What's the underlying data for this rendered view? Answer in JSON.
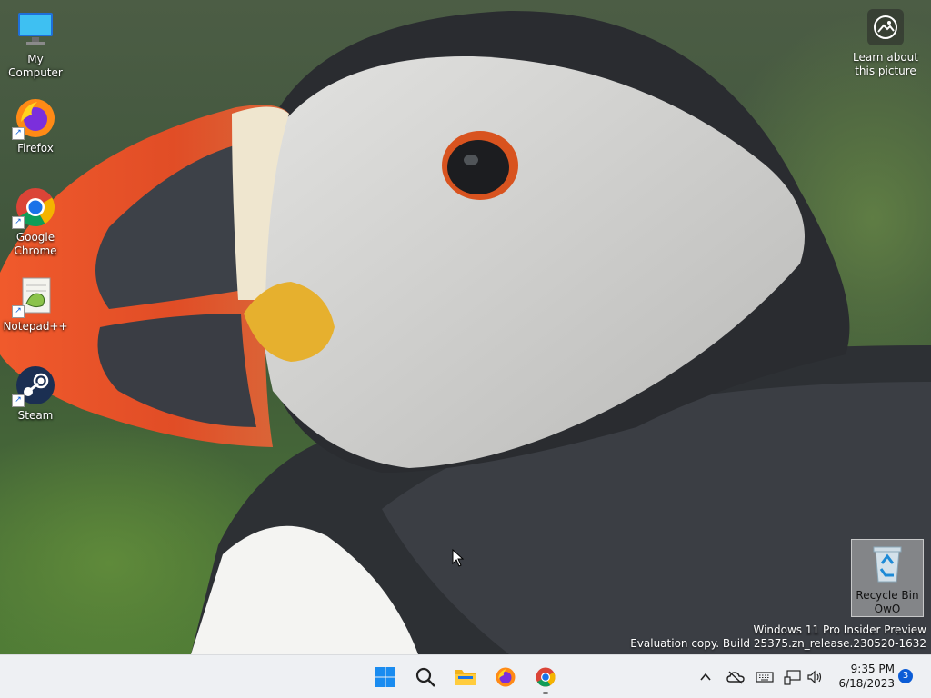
{
  "desktop": {
    "icons": [
      {
        "label": "My Computer",
        "icon": "monitor-icon"
      },
      {
        "label": "Firefox",
        "icon": "firefox-icon"
      },
      {
        "label": "Google Chrome",
        "icon": "chrome-icon"
      },
      {
        "label": "Notepad++",
        "icon": "notepadpp-icon"
      },
      {
        "label": "Steam",
        "icon": "steam-icon"
      }
    ],
    "learn_about": {
      "line1": "Learn about",
      "line2": "this picture",
      "icon": "camera-icon"
    },
    "recycle_bin": {
      "line1": "Recycle Bin",
      "line2": "OwO",
      "icon": "recycle-bin-icon"
    },
    "watermark": {
      "line1": "Windows 11 Pro Insider Preview",
      "line2": "Evaluation copy. Build 25375.zn_release.230520-1632"
    }
  },
  "taskbar": {
    "apps": [
      {
        "name": "start",
        "icon": "windows-logo-icon"
      },
      {
        "name": "search",
        "icon": "search-icon"
      },
      {
        "name": "file-explorer",
        "icon": "folder-icon"
      },
      {
        "name": "firefox",
        "icon": "firefox-icon"
      },
      {
        "name": "chrome",
        "icon": "chrome-icon"
      }
    ],
    "tray": {
      "icons": [
        "chevron-up-icon",
        "onedrive-offline-icon",
        "keyboard-icon",
        "network-icon",
        "volume-icon"
      ],
      "time": "9:35 PM",
      "date": "6/18/2023",
      "notification_count": "3"
    }
  },
  "colors": {
    "taskbar_bg": "#eef0f3",
    "accent": "#0b5cd6",
    "puffin_beak_orange": "#e4542a",
    "puffin_face_white": "#d8d8d6",
    "puffin_black": "#2b2d30"
  }
}
